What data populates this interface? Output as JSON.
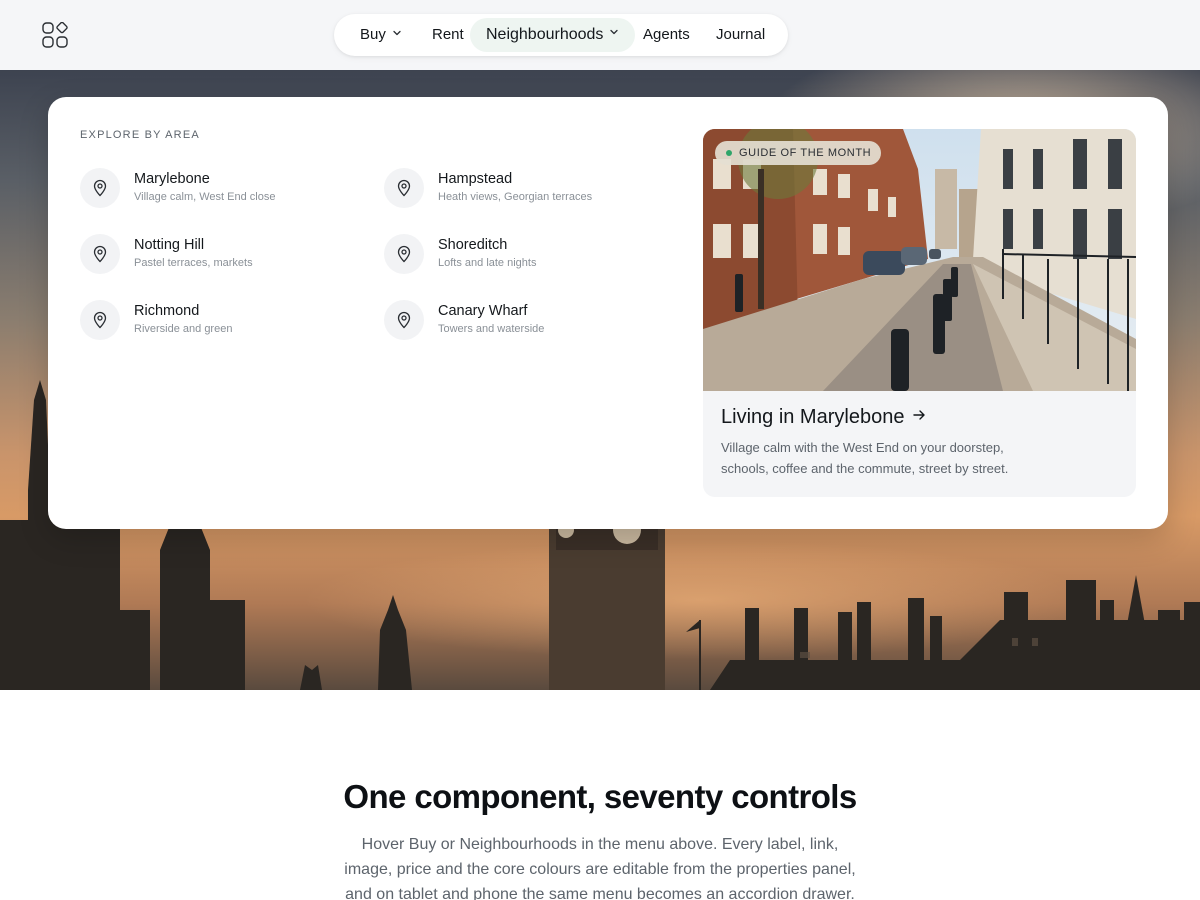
{
  "nav": {
    "logo_icon": "grid-logo-icon",
    "items": [
      {
        "label": "Buy",
        "has_dropdown": true
      },
      {
        "label": "Rent",
        "has_dropdown": false
      },
      {
        "label": "Neighbourhoods",
        "has_dropdown": true,
        "active": true
      },
      {
        "label": "Agents",
        "has_dropdown": false
      },
      {
        "label": "Journal",
        "has_dropdown": false
      }
    ]
  },
  "mega_menu": {
    "section_label": "EXPLORE BY AREA",
    "areas": [
      {
        "name": "Marylebone",
        "subtitle": "Village calm, West End close",
        "icon": "map-pin-icon"
      },
      {
        "name": "Hampstead",
        "subtitle": "Heath views, Georgian terraces",
        "icon": "map-pin-icon"
      },
      {
        "name": "Notting Hill",
        "subtitle": "Pastel terraces, markets",
        "icon": "map-pin-icon"
      },
      {
        "name": "Shoreditch",
        "subtitle": "Lofts and late nights",
        "icon": "map-pin-icon"
      },
      {
        "name": "Richmond",
        "subtitle": "Riverside and green",
        "icon": "map-pin-icon"
      },
      {
        "name": "Canary Wharf",
        "subtitle": "Towers and waterside",
        "icon": "map-pin-icon"
      }
    ],
    "feature": {
      "badge": "GUIDE OF THE MONTH",
      "title": "Living in Marylebone",
      "description": "Village calm with the West End on your doorstep, schools, coffee and the commute, street by street."
    }
  },
  "section": {
    "title": "One component, seventy controls",
    "text": "Hover Buy or Neighbourhoods in the menu above. Every label, link, image, price and the core colours are editable from the properties panel, and on tablet and phone the same menu becomes an accordion drawer."
  },
  "colors": {
    "accent_green": "#2fa56a",
    "active_nav_bg": "#eef5f1",
    "text_primary": "#14181c",
    "text_muted": "#5d646c"
  }
}
